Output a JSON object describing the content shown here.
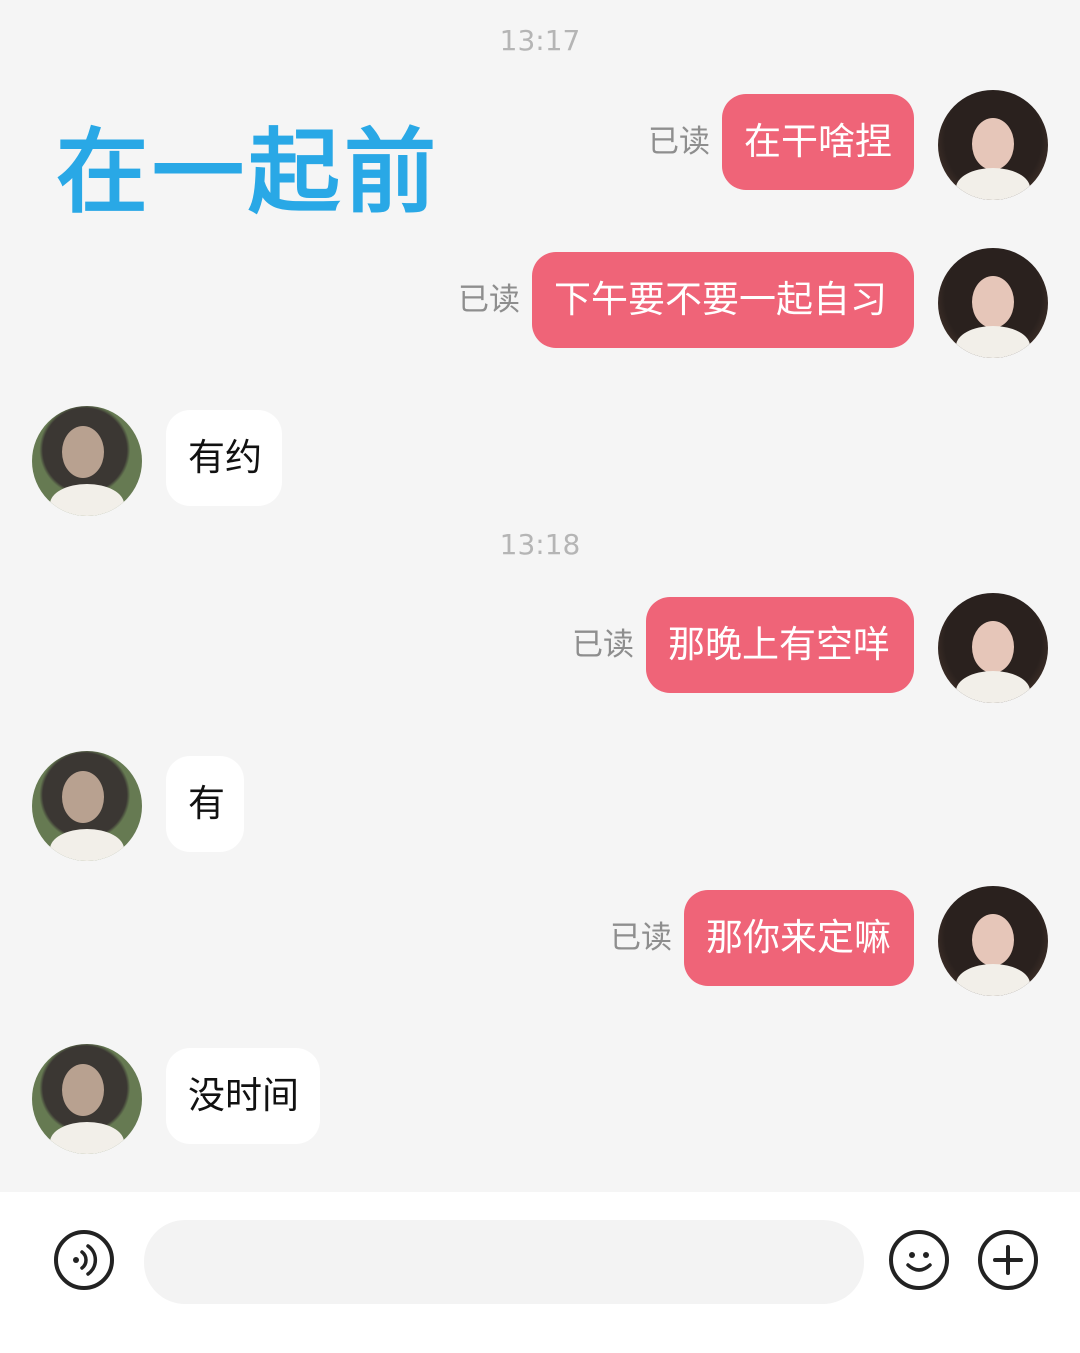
{
  "overlay_title": "在一起前",
  "timestamps": [
    "13:17",
    "13:18"
  ],
  "read_label": "已读",
  "messages": [
    {
      "side": "out",
      "text": "在干啥捏"
    },
    {
      "side": "out",
      "text": "下午要不要一起自习"
    },
    {
      "side": "in",
      "text": "有约"
    },
    {
      "side": "out",
      "text": "那晚上有空咩"
    },
    {
      "side": "in",
      "text": "有"
    },
    {
      "side": "out",
      "text": "那你来定嘛"
    },
    {
      "side": "in",
      "text": "没时间"
    }
  ],
  "input": {
    "placeholder": ""
  },
  "icons": {
    "voice": "voice-icon",
    "emoji": "emoji-icon",
    "plus": "plus-icon"
  },
  "colors": {
    "background": "#f5f5f5",
    "outgoing_bubble": "#ef6478",
    "incoming_bubble": "#ffffff",
    "overlay_title": "#29a8e6"
  }
}
